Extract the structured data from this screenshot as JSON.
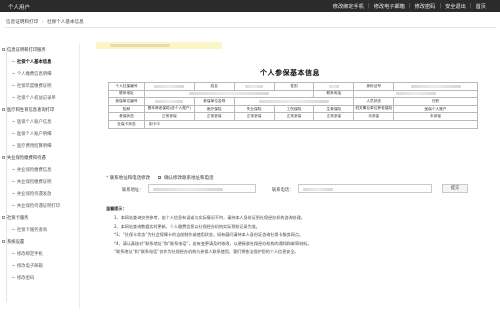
{
  "topbar": {
    "title": "个人用户",
    "nav": [
      "修改绑定手机",
      "修改电子邮箱",
      "修改密码",
      "安全退出",
      "首页"
    ]
  },
  "breadcrumb": [
    "信息证明和打印",
    "社保个人基本信息"
  ],
  "sidebar": {
    "items": [
      {
        "label": "信息证明和打印服务",
        "type": "group"
      },
      {
        "label": "社保个人基本信息",
        "type": "child",
        "active": true
      },
      {
        "label": "个人缴费信息明细",
        "type": "child"
      },
      {
        "label": "社保年度缴费证明",
        "type": "child"
      },
      {
        "label": "社保个人权益记录单",
        "type": "child"
      },
      {
        "label": "医疗和生育信息查询打印",
        "type": "group"
      },
      {
        "label": "医保个人账户信息",
        "type": "child"
      },
      {
        "label": "医保个人账户明细",
        "type": "child"
      },
      {
        "label": "医疗费用结算明细",
        "type": "child"
      },
      {
        "label": "失业保险缴费和待遇",
        "type": "group"
      },
      {
        "label": "失业保险缴费信息",
        "type": "child"
      },
      {
        "label": "失业保险缴费证明",
        "type": "child"
      },
      {
        "label": "失业保险待遇发放",
        "type": "child"
      },
      {
        "label": "失业保险待遇证明打印",
        "type": "child"
      },
      {
        "label": "社保卡服务",
        "type": "group"
      },
      {
        "label": "社保卡服务查询",
        "type": "child"
      },
      {
        "label": "系统设置",
        "type": "group"
      },
      {
        "label": "修改绑定手机",
        "type": "child"
      },
      {
        "label": "修改电子邮箱",
        "type": "child"
      },
      {
        "label": "修改密码",
        "type": "child"
      }
    ]
  },
  "card_title": "个人参保基本信息",
  "table": {
    "row1": [
      "个人社保编号",
      "姓名",
      "性别",
      "身份证号"
    ],
    "row2": [
      "联系地址",
      "联系电话"
    ],
    "row3": [
      "参保单位编号",
      "参保单位名称",
      "人员状态",
      "在职"
    ],
    "row4": [
      "险种",
      "基本养老保险(含个人账户)",
      "医疗保险",
      "失业保险",
      "工伤保险",
      "生育保险",
      "机关事业单位养老保险",
      "医保个人账户"
    ],
    "row5": [
      "参保状态",
      "正常参保",
      "正常参保",
      "正常参保",
      "正常参保",
      "正常参保",
      "未参保",
      "未参保"
    ],
    "row6": [
      "社保卡状态",
      "制卡中"
    ]
  },
  "contact": {
    "heading": "联系地址和电话修改",
    "checkbox_label": "确认修改联系地址和电话",
    "address_label": "联系地址：",
    "phone_label": "联系电话：",
    "submit": "提交"
  },
  "tips": {
    "title": "温馨提示：",
    "lines": [
      "1、本网站查询仅供参考，若个人信息有误或与实际情况不符，请持本人身份证到社保经办机构咨询处理。",
      "2、本网站查询数据实时更新，个人缴费信息以社保经办机构实际到账记录为准。",
      "*3、“社保卡状态”为社会保障卡的当前制作或使用状态，如有疑问请持本人身份证咨询社保卡服务网点。",
      "*4、请认真核对“联系地址”和“联系电话”，若有变更请及时修改，以便接收社保经办机构的通知和邮寄材料。",
      "“联系地址”和“联系电话”仅作为社保经办机构与参保人联系使用，我们将依法保护您的个人信息安全。"
    ]
  },
  "colors": {
    "topbar_bg": "#2b2b2b",
    "notice_bg": "#fbf5c8",
    "required_star": "#c0392b"
  }
}
